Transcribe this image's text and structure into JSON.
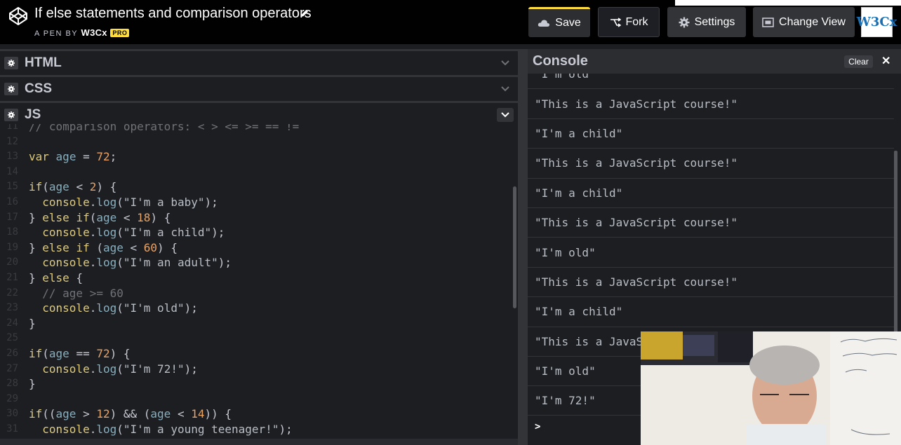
{
  "header": {
    "title": "If else statements and comparison operators",
    "byline_prefix": "A PEN BY",
    "author": "W3Cx",
    "badge": "PRO",
    "buttons": {
      "save": "Save",
      "fork": "Fork",
      "settings": "Settings",
      "change_view": "Change View"
    },
    "avatar_text": "W3Cx"
  },
  "panels": {
    "html": "HTML",
    "css": "CSS",
    "js": "JS"
  },
  "code": [
    {
      "n": "11",
      "t": "// comparison operators: < > <= >= == !="
    },
    {
      "n": "12",
      "t": ""
    },
    {
      "n": "13",
      "t": "var age = 72;"
    },
    {
      "n": "14",
      "t": ""
    },
    {
      "n": "15",
      "t": "if(age < 2) {"
    },
    {
      "n": "16",
      "t": "  console.log(\"I'm a baby\");"
    },
    {
      "n": "17",
      "t": "} else if(age < 18) {"
    },
    {
      "n": "18",
      "t": "  console.log(\"I'm a child\");"
    },
    {
      "n": "19",
      "t": "} else if (age < 60) {"
    },
    {
      "n": "20",
      "t": "  console.log(\"I'm an adult\");"
    },
    {
      "n": "21",
      "t": "} else {"
    },
    {
      "n": "22",
      "t": "  // age >= 60"
    },
    {
      "n": "23",
      "t": "  console.log(\"I'm old\");"
    },
    {
      "n": "24",
      "t": "}"
    },
    {
      "n": "25",
      "t": ""
    },
    {
      "n": "26",
      "t": "if(age == 72) {"
    },
    {
      "n": "27",
      "t": "  console.log(\"I'm 72!\");"
    },
    {
      "n": "28",
      "t": "}"
    },
    {
      "n": "29",
      "t": ""
    },
    {
      "n": "30",
      "t": "if((age > 12) && (age < 14)) {"
    },
    {
      "n": "31",
      "t": "  console.log(\"I'm a young teenager!\");"
    }
  ],
  "console": {
    "title": "Console",
    "clear_label": "Clear",
    "close_label": "✕",
    "prompt": ">",
    "logs": [
      "\"I'm old\"",
      "\"This is a JavaScript course!\"",
      "\"I'm a child\"",
      "\"This is a JavaScript course!\"",
      "\"I'm a child\"",
      "\"This is a JavaScript course!\"",
      "\"I'm old\"",
      "\"This is a JavaScript course!\"",
      "\"I'm a child\"",
      "\"This is a JavaScript course!\"",
      "\"I'm old\"",
      "\"I'm 72!\""
    ]
  },
  "colors": {
    "accent": "#ffdd40",
    "background": "#1d1e22",
    "header": "#010101"
  }
}
